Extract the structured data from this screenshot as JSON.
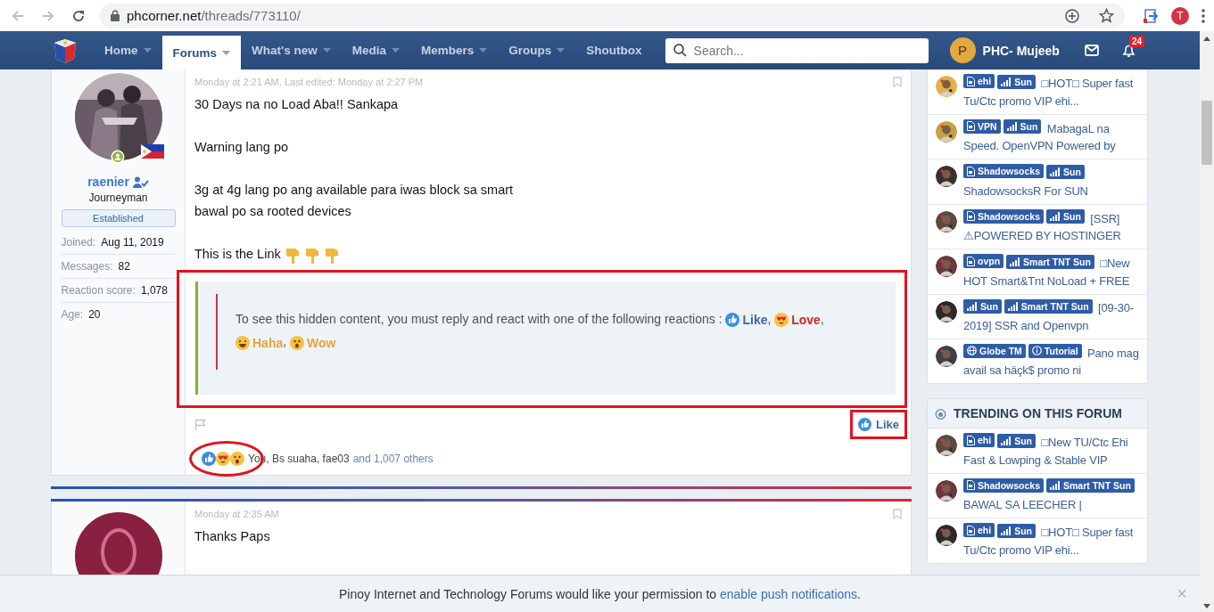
{
  "browser": {
    "url_host": "phcorner.net",
    "url_path": "/threads/773110/",
    "profile_initial": "T"
  },
  "nav": {
    "tabs": [
      {
        "label": "Home",
        "selected": false,
        "dropdown": true
      },
      {
        "label": "Forums",
        "selected": true,
        "dropdown": true
      },
      {
        "label": "What's new",
        "selected": false,
        "dropdown": true
      },
      {
        "label": "Media",
        "selected": false,
        "dropdown": true
      },
      {
        "label": "Members",
        "selected": false,
        "dropdown": true
      },
      {
        "label": "Groups",
        "selected": false,
        "dropdown": true
      },
      {
        "label": "Shoutbox",
        "selected": false,
        "dropdown": false
      }
    ],
    "search": {
      "placeholder": "Search..."
    },
    "user": {
      "initial": "P",
      "name": "PHC- Mujeeb"
    },
    "notifications_badge": "24"
  },
  "post": {
    "author": {
      "name": "raenier",
      "title": "Journeyman",
      "banner": "Established",
      "stats": [
        {
          "label": "Joined:",
          "value": "Aug 11, 2019"
        },
        {
          "label": "Messages:",
          "value": "82"
        },
        {
          "label": "Reaction score:",
          "value": "1,078"
        },
        {
          "label": "Age:",
          "value": "20"
        }
      ]
    },
    "date": "Monday at 2:21 AM, Last edited: Monday at 2:27 PM",
    "paragraphs": [
      {
        "lines": [
          "30 Days na no Load Aba!! Sankapa"
        ]
      },
      {
        "lines": [
          "Warning lang po"
        ]
      },
      {
        "lines": [
          "3g at 4g lang po ang available para iwas block sa smart",
          "bawal po sa rooted devices"
        ]
      },
      {
        "lines": [
          "This is the Link"
        ],
        "trailing_icons": [
          {
            "kind": "pointing-down"
          },
          {
            "kind": "pointing-down"
          },
          {
            "kind": "pointing-down"
          }
        ]
      }
    ],
    "hidden_notice": {
      "text": "To see this hidden content, you must reply and react with one of the following reactions :",
      "reactions": [
        {
          "kind": "like",
          "label": "Like",
          "after": ",",
          "color": "#3f67a8"
        },
        {
          "kind": "love",
          "label": "Love",
          "after": ",",
          "color": "#d8281f"
        },
        {
          "kind": "haha",
          "label": "Haha",
          "after": ",",
          "color": "#e8a33d"
        },
        {
          "kind": "wow",
          "label": "Wow",
          "color": "#e8a33d"
        }
      ]
    },
    "like_button": {
      "label": "Like"
    },
    "reactions_summary": {
      "icons": [
        {
          "kind": "like"
        },
        {
          "kind": "love"
        },
        {
          "kind": "wow"
        }
      ],
      "names": "You, Bs suaha, fae03",
      "others": "and 1,007 others"
    }
  },
  "post2": {
    "date": "Monday at 2:35 AM",
    "text": "Thanks Paps"
  },
  "sidebar": {
    "threads": [
      {
        "tags": [
          {
            "kind": "file",
            "label": "ehi"
          },
          {
            "kind": "signal",
            "label": "Sun"
          }
        ],
        "title": "□HOT□ Super fast Tu/Ctc promo VIP ehi..."
      },
      {
        "tags": [
          {
            "kind": "file",
            "label": "VPN"
          },
          {
            "kind": "signal",
            "label": "Sun"
          }
        ],
        "title": "MabagaL na Speed. OpenVPN Powered by"
      },
      {
        "tags": [
          {
            "kind": "file",
            "label": "Shadowsocks"
          },
          {
            "kind": "signal",
            "label": "Sun"
          }
        ],
        "title": "ShadowsocksR For SUN"
      },
      {
        "tags": [
          {
            "kind": "file",
            "label": "Shadowsocks"
          },
          {
            "kind": "signal",
            "label": "Sun"
          }
        ],
        "title": "[SSR] ⚠POWERED BY HOSTINGER"
      },
      {
        "tags": [
          {
            "kind": "file",
            "label": "ovpn"
          },
          {
            "kind": "signal",
            "label": "Smart TNT Sun"
          }
        ],
        "title": "□New HOT Smart&Tnt NoLoad + FREE"
      },
      {
        "tags": [
          {
            "kind": "signal",
            "label": "Sun"
          },
          {
            "kind": "signal",
            "label": "Smart TNT Sun"
          }
        ],
        "title": "[09-30-2019] SSR and Openvpn"
      },
      {
        "tags": [
          {
            "kind": "globe",
            "label": "Globe TM"
          },
          {
            "kind": "info",
            "label": "Tutorial"
          }
        ],
        "title": "Pano mag avail sa häçk$ promo ni"
      }
    ],
    "trending": {
      "title": "TRENDING ON THIS FORUM",
      "threads": [
        {
          "tags": [
            {
              "kind": "file",
              "label": "ehi"
            },
            {
              "kind": "signal",
              "label": "Sun"
            }
          ],
          "title": "□New TU/Ctc Ehi Fast & Lowping & Stable VIP"
        },
        {
          "tags": [
            {
              "kind": "file",
              "label": "Shadowsocks"
            },
            {
              "kind": "signal",
              "label": "Smart TNT Sun"
            }
          ],
          "title": "BAWAL SA LEECHER |"
        },
        {
          "tags": [
            {
              "kind": "file",
              "label": "ehi"
            },
            {
              "kind": "signal",
              "label": "Sun"
            }
          ],
          "title": "□HOT□ Super fast Tu/Ctc promo VIP ehi..."
        }
      ]
    }
  },
  "notice": {
    "text": "Pinoy Internet and Technology Forums would like your permission to",
    "link": "enable push notifications",
    "end": ".",
    "close": "×"
  }
}
